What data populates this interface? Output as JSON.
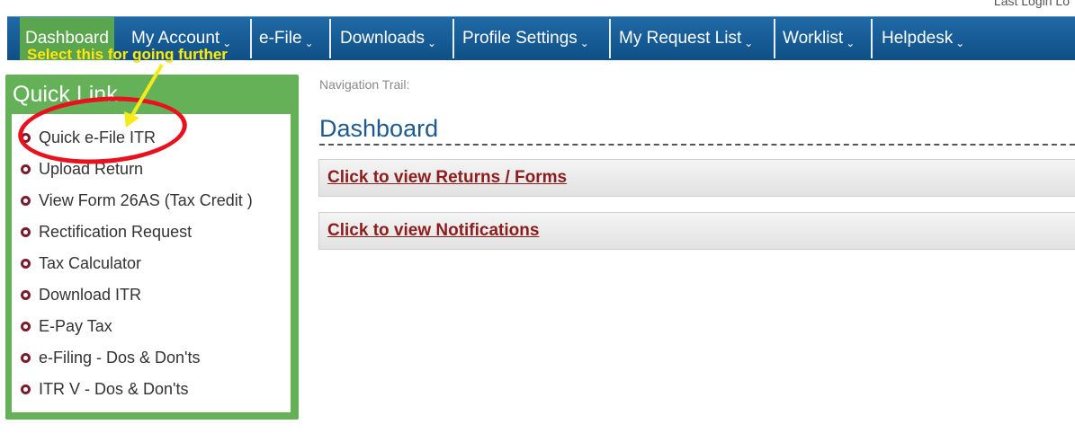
{
  "header": {
    "last_login": "Last Login Lo"
  },
  "nav": {
    "items": [
      {
        "label": "Dashboard",
        "active": true
      },
      {
        "label": "My Account",
        "caret": true
      },
      {
        "label": "e-File",
        "caret": true
      },
      {
        "label": "Downloads",
        "caret": true
      },
      {
        "label": "Profile Settings",
        "caret": true
      },
      {
        "label": "My Request List",
        "caret": true
      },
      {
        "label": "Worklist",
        "caret": true
      },
      {
        "label": "Helpdesk",
        "caret": true
      }
    ],
    "caret_glyph": "⌄"
  },
  "annotation": {
    "text": "Select this for going further",
    "color": "#f7ea1b",
    "circle_color": "#e8121e"
  },
  "quick_link": {
    "title": "Quick Link",
    "items": [
      "Quick e-File ITR",
      "Upload Return",
      "View Form 26AS (Tax Credit )",
      "Rectification Request",
      "Tax Calculator",
      "Download ITR",
      "E-Pay Tax",
      "e-Filing - Dos & Don'ts",
      "ITR V - Dos & Don'ts"
    ]
  },
  "main": {
    "nav_trail": "Navigation Trail:",
    "title": "Dashboard",
    "panels": [
      "Click to view Returns / Forms",
      "Click to view Notifications"
    ]
  },
  "colors": {
    "nav_bg": "#1a5f9c",
    "nav_active": "#5aa64e",
    "quick_link_green": "#64b158",
    "link_red": "#8c1d1d",
    "title_blue": "#1f5a8e"
  }
}
